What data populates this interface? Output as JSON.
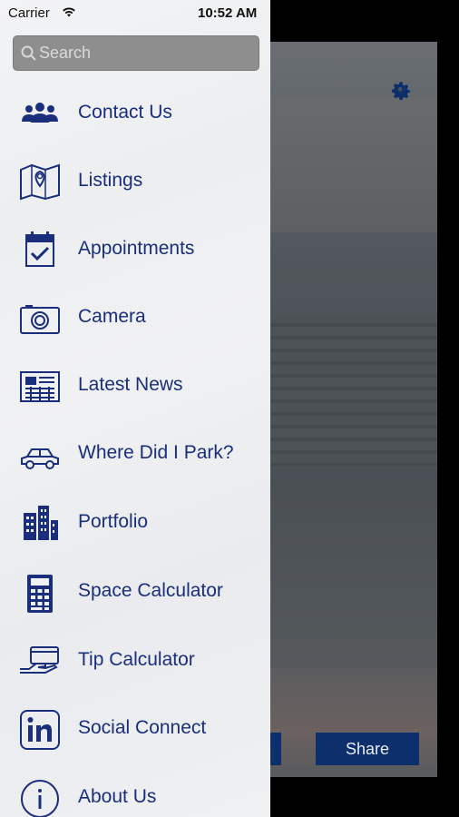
{
  "status_bar": {
    "carrier": "Carrier",
    "time": "10:52 AM"
  },
  "search": {
    "placeholder": "Search"
  },
  "menu": {
    "items": [
      {
        "label": "Contact Us",
        "icon": "people-icon"
      },
      {
        "label": "Listings",
        "icon": "map-pin-icon"
      },
      {
        "label": "Appointments",
        "icon": "calendar-check-icon"
      },
      {
        "label": "Camera",
        "icon": "camera-icon"
      },
      {
        "label": "Latest News",
        "icon": "newspaper-icon"
      },
      {
        "label": "Where Did I Park?",
        "icon": "car-icon"
      },
      {
        "label": "Portfolio",
        "icon": "buildings-icon"
      },
      {
        "label": "Space Calculator",
        "icon": "calculator-icon"
      },
      {
        "label": "Tip Calculator",
        "icon": "hand-card-icon"
      },
      {
        "label": "Social Connect",
        "icon": "linkedin-icon"
      },
      {
        "label": "About Us",
        "icon": "info-icon"
      }
    ]
  },
  "background": {
    "share_label": "Share"
  },
  "colors": {
    "accent": "#1a2e7c",
    "button": "#0d2f6b"
  }
}
